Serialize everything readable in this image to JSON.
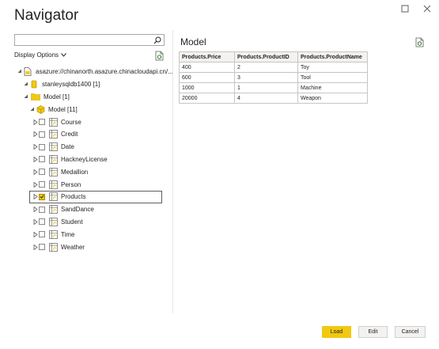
{
  "window": {
    "title": "Navigator"
  },
  "left": {
    "search": {
      "value": "",
      "placeholder": ""
    },
    "display_options_label": "Display Options",
    "tree": {
      "server": "asazure://chinanorth.asazure.chinacloudapi.cn/...",
      "database": "stanleysqldb1400 [1]",
      "model_folder": "Model [1]",
      "model_cube": "Model [11]",
      "tables": [
        {
          "label": "Course",
          "checked": false
        },
        {
          "label": "Credit",
          "checked": false
        },
        {
          "label": "Date",
          "checked": false
        },
        {
          "label": "HackneyLicense",
          "checked": false
        },
        {
          "label": "Medallion",
          "checked": false
        },
        {
          "label": "Person",
          "checked": false
        },
        {
          "label": "Products",
          "checked": true
        },
        {
          "label": "SandDance",
          "checked": false
        },
        {
          "label": "Student",
          "checked": false
        },
        {
          "label": "Time",
          "checked": false
        },
        {
          "label": "Weather",
          "checked": false
        }
      ]
    }
  },
  "right": {
    "preview_title": "Model",
    "table": {
      "columns": [
        "Products.Price",
        "Products.ProductID",
        "Products.ProductName"
      ],
      "rows": [
        [
          "400",
          "2",
          "Toy"
        ],
        [
          "600",
          "3",
          "Tool"
        ],
        [
          "1000",
          "1",
          "Machine"
        ],
        [
          "20000",
          "4",
          "Weapon"
        ]
      ]
    }
  },
  "footer": {
    "load_label": "Load",
    "edit_label": "Edit",
    "cancel_label": "Cancel"
  },
  "colors": {
    "accent": "#f2c811",
    "text": "#252423",
    "border": "#c8c6c4"
  },
  "icons": {
    "minimize": "minimize-icon",
    "close": "close-icon",
    "search": "search-icon",
    "refresh": "refresh-icon",
    "server": "server-icon",
    "database": "database-icon",
    "folder": "folder-icon",
    "cube": "cube-icon",
    "table": "table-icon"
  }
}
